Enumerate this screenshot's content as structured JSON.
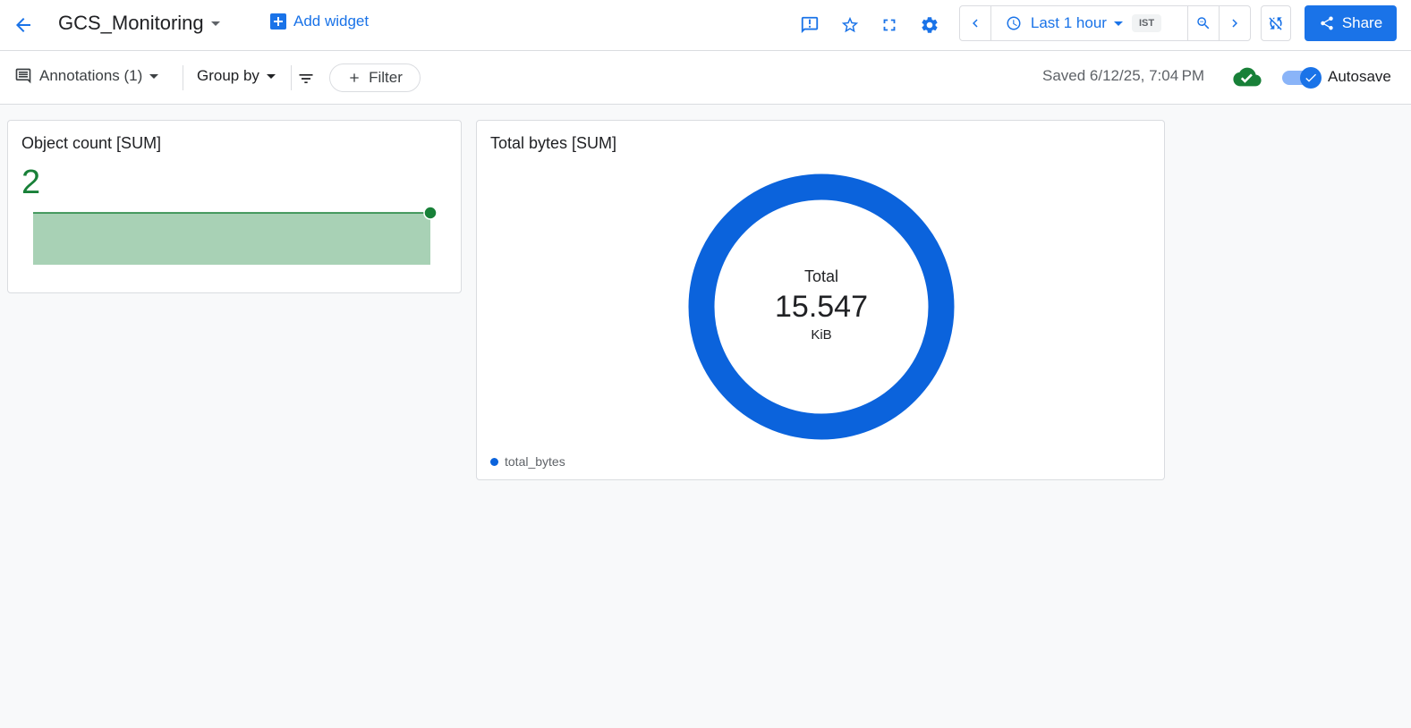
{
  "header": {
    "dashboard_title": "GCS_Monitoring",
    "add_widget_label": "Add widget",
    "time_range_label": "Last 1 hour",
    "timezone": "IST",
    "share_label": "Share"
  },
  "toolbar": {
    "annotations_label": "Annotations (1)",
    "group_by_label": "Group by",
    "filter_label": "Filter",
    "saved_text": "Saved 6/12/25, 7:04 PM",
    "autosave_label": "Autosave",
    "autosave_on": true
  },
  "widgets": {
    "object_count": {
      "title": "Object count [SUM]",
      "value": "2"
    },
    "total_bytes": {
      "title": "Total bytes [SUM]",
      "center_label": "Total",
      "center_value": "15.547",
      "center_unit": "KiB",
      "legend": "total_bytes"
    }
  },
  "colors": {
    "accent": "#1a73e8",
    "sparkline": "#188038",
    "sparkline_fill": "#a8d1b5",
    "donut": "#0b63dc"
  },
  "chart_data": [
    {
      "type": "area",
      "title": "Object count [SUM]",
      "series": [
        {
          "values": [
            2,
            2,
            2,
            2,
            2,
            2,
            2,
            2,
            2,
            2,
            2,
            2
          ]
        }
      ]
    },
    {
      "type": "pie",
      "title": "Total bytes [SUM]",
      "categories": [
        "total_bytes"
      ],
      "values": [
        15.547
      ],
      "unit": "KiB"
    }
  ]
}
